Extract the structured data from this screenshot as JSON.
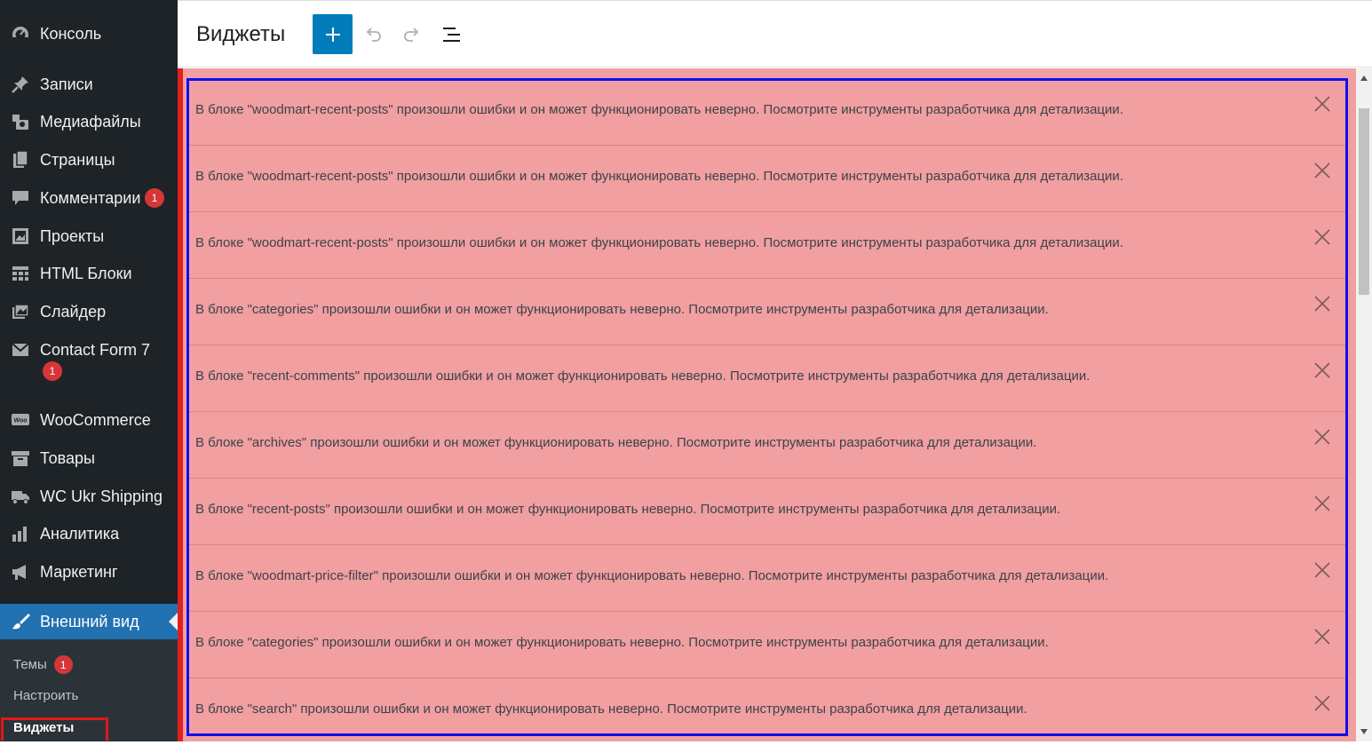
{
  "sidebar": {
    "items": [
      {
        "label": "Консоль",
        "icon": "dashboard-icon"
      },
      {
        "label": "Записи",
        "icon": "pin-icon"
      },
      {
        "label": "Медиафайлы",
        "icon": "media-icon"
      },
      {
        "label": "Страницы",
        "icon": "pages-icon"
      },
      {
        "label": "Комментарии",
        "icon": "comments-icon",
        "badge": "1"
      },
      {
        "label": "Проекты",
        "icon": "portfolio-icon"
      },
      {
        "label": "HTML Блоки",
        "icon": "grid-icon"
      },
      {
        "label": "Слайдер",
        "icon": "slider-icon"
      },
      {
        "label": "Contact Form 7",
        "icon": "mail-icon",
        "badge": "1"
      },
      {
        "label": "WooCommerce",
        "icon": "woo-icon"
      },
      {
        "label": "Товары",
        "icon": "archive-icon"
      },
      {
        "label": "WC Ukr Shipping",
        "icon": "truck-icon"
      },
      {
        "label": "Аналитика",
        "icon": "chart-bar-icon"
      },
      {
        "label": "Маркетинг",
        "icon": "megaphone-icon"
      },
      {
        "label": "Внешний вид",
        "icon": "brush-icon"
      }
    ],
    "submenu": [
      {
        "label": "Темы",
        "badge": "1"
      },
      {
        "label": "Настроить"
      },
      {
        "label": "Виджеты"
      }
    ]
  },
  "header": {
    "title": "Виджеты",
    "add_label": "+"
  },
  "notices": [
    "В блоке \"woodmart-recent-posts\" произошли ошибки и он может функционировать неверно. Посмотрите инструменты разработчика для детализации.",
    "В блоке \"woodmart-recent-posts\" произошли ошибки и он может функционировать неверно. Посмотрите инструменты разработчика для детализации.",
    "В блоке \"woodmart-recent-posts\" произошли ошибки и он может функционировать неверно. Посмотрите инструменты разработчика для детализации.",
    "В блоке \"categories\" произошли ошибки и он может функционировать неверно. Посмотрите инструменты разработчика для детализации.",
    "В блоке \"recent-comments\" произошли ошибки и он может функционировать неверно. Посмотрите инструменты разработчика для детализации.",
    "В блоке \"archives\" произошли ошибки и он может функционировать неверно. Посмотрите инструменты разработчика для детализации.",
    "В блоке \"recent-posts\" произошли ошибки и он может функционировать неверно. Посмотрите инструменты разработчика для детализации.",
    "В блоке \"woodmart-price-filter\" произошли ошибки и он может функционировать неверно. Посмотрите инструменты разработчика для детализации.",
    "В блоке \"categories\" произошли ошибки и он может функционировать неверно. Посмотрите инструменты разработчика для детализации.",
    "В блоке \"search\" произошли ошибки и он может функционировать неверно. Посмотрите инструменты разработчика для детализации."
  ],
  "colors": {
    "sidebar_bg": "#1d2327",
    "accent": "#2271b1",
    "badge": "#d63638",
    "error_bg": "#f19fa0"
  }
}
